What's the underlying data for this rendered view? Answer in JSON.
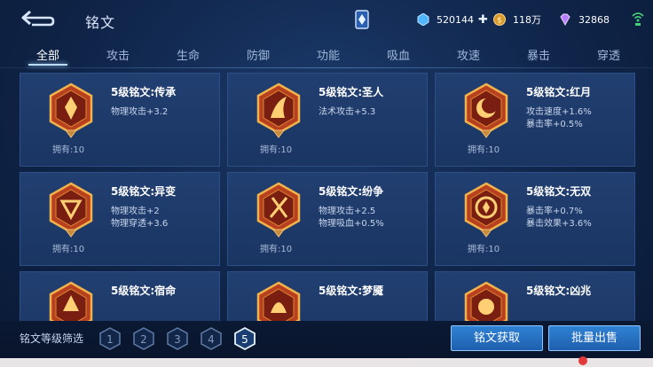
{
  "header": {
    "title": "铭文",
    "resources": [
      {
        "name": "diamond-icon",
        "value": "520144",
        "color": "#5fc3ff"
      },
      {
        "name": "gold-coin-icon",
        "value": "118万",
        "color": "#e0a53a"
      },
      {
        "name": "gem-icon",
        "value": "32868",
        "color": "#c88cff"
      }
    ]
  },
  "tabs": [
    "全部",
    "攻击",
    "生命",
    "防御",
    "功能",
    "吸血",
    "攻速",
    "暴击",
    "穿透"
  ],
  "active_tab": "全部",
  "runes": [
    {
      "name": "5级铭文:传承",
      "stats": [
        "物理攻击+3.2"
      ],
      "owned": "拥有:10",
      "icon": "rune-chuancheng-icon"
    },
    {
      "name": "5级铭文:圣人",
      "stats": [
        "法术攻击+5.3"
      ],
      "owned": "拥有:10",
      "icon": "rune-shengren-icon"
    },
    {
      "name": "5级铭文:红月",
      "stats": [
        "攻击速度+1.6%",
        "暴击率+0.5%"
      ],
      "owned": "拥有:10",
      "icon": "rune-hongyue-icon"
    },
    {
      "name": "5级铭文:异变",
      "stats": [
        "物理攻击+2",
        "物理穿透+3.6"
      ],
      "owned": "拥有:10",
      "icon": "rune-yibian-icon"
    },
    {
      "name": "5级铭文:纷争",
      "stats": [
        "物理攻击+2.5",
        "物理吸血+0.5%"
      ],
      "owned": "拥有:10",
      "icon": "rune-fenzheng-icon"
    },
    {
      "name": "5级铭文:无双",
      "stats": [
        "暴击率+0.7%",
        "暴击效果+3.6%"
      ],
      "owned": "拥有:10",
      "icon": "rune-wushuang-icon"
    },
    {
      "name": "5级铭文:宿命",
      "stats": [],
      "owned": "",
      "icon": "rune-suming-icon"
    },
    {
      "name": "5级铭文:梦魇",
      "stats": [],
      "owned": "",
      "icon": "rune-mengyan-icon"
    },
    {
      "name": "5级铭文:凶兆",
      "stats": [],
      "owned": "",
      "icon": "rune-xiongzhao-icon"
    }
  ],
  "footer": {
    "filter_label": "铭文等级筛选",
    "levels": [
      "1",
      "2",
      "3",
      "4",
      "5"
    ],
    "selected_level": "5",
    "get_button": "铭文获取",
    "sell_button": "批量出售"
  }
}
